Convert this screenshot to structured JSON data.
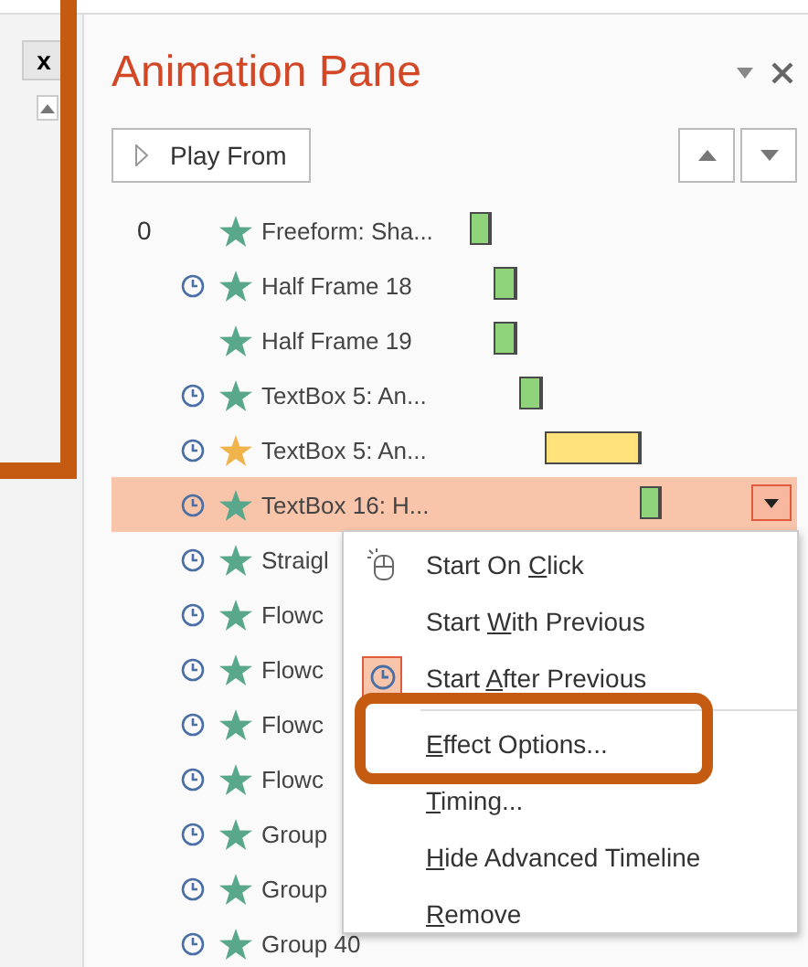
{
  "left_panel": {
    "close_label": "x"
  },
  "pane": {
    "title": "Animation Pane",
    "play_button": "Play From"
  },
  "rows": [
    {
      "number": "0",
      "clock": false,
      "color": "#5aa88c",
      "name": "Freeform: Sha...",
      "bar": {
        "color": "#8fd47a"
      },
      "selected": false
    },
    {
      "clock": true,
      "color": "#5aa88c",
      "name": "Half Frame 18",
      "bar": {
        "color": "#8fd47a"
      },
      "selected": false
    },
    {
      "clock": false,
      "color": "#5aa88c",
      "name": "Half Frame 19",
      "bar": {
        "color": "#8fd47a"
      },
      "selected": false
    },
    {
      "clock": true,
      "color": "#5aa88c",
      "name": "TextBox 5: An...",
      "bar": {
        "color": "#8fd47a"
      },
      "selected": false
    },
    {
      "clock": true,
      "color": "#f0b44c",
      "name": "TextBox 5: An...",
      "bar": {
        "color": "#ffe27a"
      },
      "selected": false
    },
    {
      "clock": true,
      "color": "#5aa88c",
      "name": "TextBox 16: H...",
      "bar": {
        "color": "#8fd47a"
      },
      "selected": true
    },
    {
      "clock": true,
      "color": "#5aa88c",
      "name": "Straigl",
      "selected": false
    },
    {
      "clock": true,
      "color": "#5aa88c",
      "name": "Flowc",
      "selected": false
    },
    {
      "clock": true,
      "color": "#5aa88c",
      "name": "Flowc",
      "selected": false
    },
    {
      "clock": true,
      "color": "#5aa88c",
      "name": "Flowc",
      "selected": false
    },
    {
      "clock": true,
      "color": "#5aa88c",
      "name": "Flowc",
      "selected": false
    },
    {
      "clock": true,
      "color": "#5aa88c",
      "name": "Group",
      "selected": false
    },
    {
      "clock": true,
      "color": "#5aa88c",
      "name": "Group",
      "selected": false
    },
    {
      "clock": true,
      "color": "#5aa88c",
      "name": "Group 40",
      "selected": false
    }
  ],
  "context_menu": [
    {
      "kind": "timing",
      "before": "Start On ",
      "key": "C",
      "after": "lick",
      "selected": false
    },
    {
      "kind": "timing",
      "before": "Start ",
      "key": "W",
      "after": "ith Previous",
      "selected": false
    },
    {
      "kind": "timing",
      "before": "Start ",
      "key": "A",
      "after": "fter Previous",
      "selected": true
    },
    {
      "kind": "separator"
    },
    {
      "kind": "command",
      "key": "E",
      "after": "ffect Options...",
      "highlighted": true
    },
    {
      "kind": "command",
      "key": "T",
      "after": "iming...",
      "highlighted": false
    },
    {
      "kind": "command",
      "key": "H",
      "after": "ide Advanced Timeline",
      "highlighted": false
    },
    {
      "kind": "command",
      "key": "R",
      "after": "emove",
      "highlighted": false
    }
  ]
}
